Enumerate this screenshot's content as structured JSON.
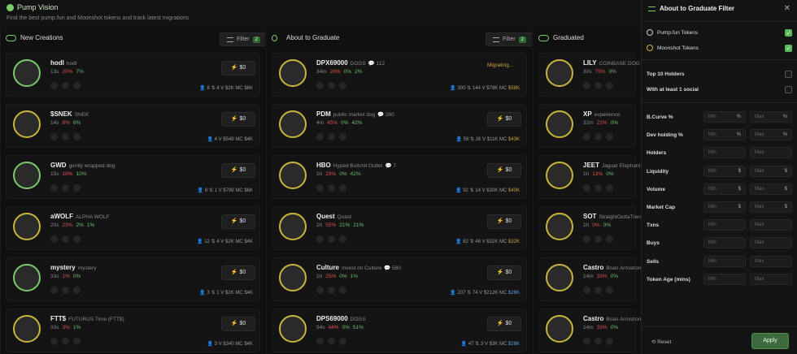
{
  "app": {
    "title": "Pump Vision",
    "tagline": "Find the best pump.fun and Moonshot tokens and track latest migrations"
  },
  "columns": [
    {
      "title": "New Creations",
      "filter_label": "Filter",
      "filter_count": "2"
    },
    {
      "title": "About to Graduate",
      "filter_label": "Filter",
      "filter_count": "2"
    },
    {
      "title": "Graduated"
    }
  ],
  "new_creations": [
    {
      "name": "hodl",
      "full": "hodl",
      "age": "13s",
      "a": "20%",
      "b": "7%",
      "holders": "8",
      "vol_n": "4",
      "vol": "$2K",
      "mc": "$6K",
      "buy": "$0"
    },
    {
      "name": "$SNEK",
      "full": "SNEK",
      "age": "14s",
      "a": "8%",
      "b": "6%",
      "holders": "4",
      "vol_n": "",
      "vol": "$549",
      "mc": "$4K",
      "buy": "$0"
    },
    {
      "name": "GWD",
      "full": "gently wrapped dog",
      "age": "15s",
      "a": "18%",
      "b": "10%",
      "holders": "8",
      "vol_n": "1",
      "vol": "$799",
      "mc": "$6K",
      "buy": "$0"
    },
    {
      "name": "aWOLF",
      "full": "ALPHA WOLF",
      "age": "20s",
      "a": "23%",
      "b": "2%",
      "c": "1%",
      "holders": "12",
      "vol_n": "4",
      "vol": "$2K",
      "mc": "$4K",
      "buy": "$0"
    },
    {
      "name": "mystery",
      "full": "mystery",
      "age": "33s",
      "a": "1%",
      "b": "0%",
      "holders": "3",
      "vol_n": "1",
      "vol": "$2K",
      "mc": "$4K",
      "buy": "$0"
    },
    {
      "name": "FTT$",
      "full": "FUTURUS Time (FTT$)",
      "age": "33s",
      "a": "3%",
      "b": "1%",
      "holders": "3",
      "vol_n": "",
      "vol": "$340",
      "mc": "$4K",
      "buy": "$0"
    }
  ],
  "graduating": [
    {
      "name": "DPX69000",
      "full": "DOGS",
      "replies": "112",
      "age": "34m",
      "a": "28%",
      "b": "0%",
      "c": "2%",
      "holders": "300",
      "vol_n": "144",
      "vol": "$79K",
      "mc": "$58K",
      "status": "Migrating..."
    },
    {
      "name": "PDM",
      "full": "public market dog",
      "replies": "260",
      "age": "4m",
      "a": "45%",
      "b": "0%",
      "c": "42%",
      "holders": "59",
      "vol_n": "26",
      "vol": "$11K",
      "mc": "$43K",
      "buy": "$0"
    },
    {
      "name": "HBO",
      "full": "Hyped Bullshit Outlet",
      "replies": "7",
      "age": "1h",
      "a": "29%",
      "b": "0%",
      "c": "42%",
      "holders": "92",
      "vol_n": "14",
      "vol": "$30K",
      "mc": "$40K",
      "buy": "$0"
    },
    {
      "name": "Quest",
      "full": "Quest",
      "age": "1h",
      "a": "55%",
      "b": "21%",
      "c": "21%",
      "holders": "82",
      "vol_n": "46",
      "vol": "$31K",
      "mc": "$32K",
      "buy": "$0"
    },
    {
      "name": "Culture",
      "full": "Invest on Culture",
      "replies": "560",
      "age": "1h",
      "a": "25%",
      "b": "0%",
      "c": "1%",
      "holders": "207",
      "vol_n": "74",
      "vol": "$212K",
      "mc": "$28K",
      "buy": "$0"
    },
    {
      "name": "DPS69000",
      "full": "DOGS",
      "age": "54s",
      "a": "44%",
      "b": "0%",
      "c": "51%",
      "holders": "47",
      "vol_n": "3",
      "vol": "$3K",
      "mc": "$28K",
      "buy": "$0"
    }
  ],
  "graduated": [
    {
      "name": "LILY",
      "full": "COINBASE DOG",
      "age": "30s",
      "a": "75%",
      "b": "0%"
    },
    {
      "name": "XP",
      "full": "experience",
      "age": "32m",
      "a": "21%",
      "b": "0%"
    },
    {
      "name": "JEET",
      "full": "Jaguar Elephant Ea",
      "age": "1h",
      "a": "13%",
      "b": "0%"
    },
    {
      "name": "SOT",
      "full": "StraightOuttaTrench",
      "age": "1h",
      "a": "0%",
      "b": "0%"
    },
    {
      "name": "Castro",
      "full": "Brian Armstrong",
      "age": "14m",
      "a": "33%",
      "b": "0%"
    },
    {
      "name": "Castro",
      "full": "Brian Armstron's",
      "age": "14m",
      "a": "33%",
      "b": "0%"
    }
  ],
  "panel": {
    "title": "About to Graduate Filter",
    "pump_label": "Pump.fun Tokens",
    "moon_label": "Moonshot Tokens",
    "top10_label": "Top 10 Holders",
    "social_label": "With at least 1 social",
    "filters": [
      {
        "label": "B.Curve %",
        "suffix": "%"
      },
      {
        "label": "Dev holding %",
        "suffix": "%"
      },
      {
        "label": "Holders",
        "suffix": ""
      },
      {
        "label": "Liquidity",
        "suffix": "$"
      },
      {
        "label": "Volume",
        "suffix": "$"
      },
      {
        "label": "Market Cap",
        "suffix": "$"
      },
      {
        "label": "Txns",
        "suffix": ""
      },
      {
        "label": "Buys",
        "suffix": ""
      },
      {
        "label": "Sells",
        "suffix": ""
      },
      {
        "label": "Token Age (mins)",
        "suffix": ""
      }
    ],
    "min": "Min",
    "max": "Max",
    "reset": "Reset",
    "apply": "Apply"
  },
  "colors": {
    "accent": "#7ac96b",
    "gold": "#c9b53a",
    "red": "#d9534f",
    "green": "#6dbf6d"
  }
}
